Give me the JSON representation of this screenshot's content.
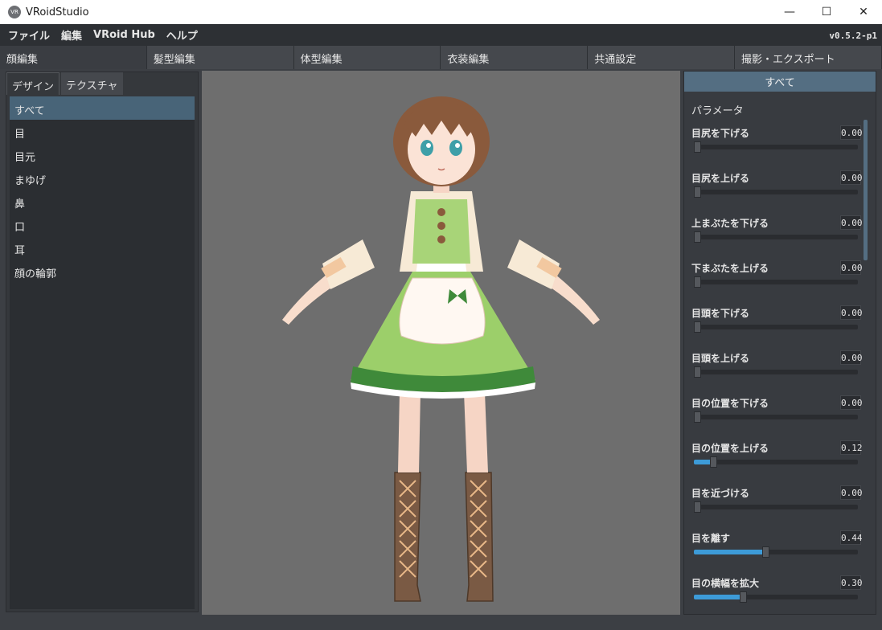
{
  "window": {
    "title": "VRoidStudio",
    "icon_text": "VR",
    "controls": {
      "minimize": "—",
      "maximize": "☐",
      "close": "✕"
    }
  },
  "menubar": {
    "items": [
      "ファイル",
      "編集",
      "VRoid Hub",
      "ヘルプ"
    ],
    "version": "v0.5.2-p1"
  },
  "main_tabs": [
    "顔編集",
    "髪型編集",
    "体型編集",
    "衣装編集",
    "共通設定",
    "撮影・エクスポート"
  ],
  "left_panel": {
    "subtabs": [
      "デザイン",
      "テクスチャ"
    ],
    "categories": [
      "すべて",
      "目",
      "目元",
      "まゆげ",
      "鼻",
      "口",
      "耳",
      "顔の輪郭"
    ]
  },
  "right_panel": {
    "header": "すべて",
    "section_label": "パラメータ",
    "params": [
      {
        "label": "目尻を下げる",
        "value": "0.00",
        "level": 0.0
      },
      {
        "label": "目尻を上げる",
        "value": "0.00",
        "level": 0.0
      },
      {
        "label": "上まぶたを下げる",
        "value": "0.00",
        "level": 0.0
      },
      {
        "label": "下まぶたを上げる",
        "value": "0.00",
        "level": 0.0
      },
      {
        "label": "目頭を下げる",
        "value": "0.00",
        "level": 0.0
      },
      {
        "label": "目頭を上げる",
        "value": "0.00",
        "level": 0.0
      },
      {
        "label": "目の位置を下げる",
        "value": "0.00",
        "level": 0.0
      },
      {
        "label": "目の位置を上げる",
        "value": "0.12",
        "level": 0.12
      },
      {
        "label": "目を近づける",
        "value": "0.00",
        "level": 0.0
      },
      {
        "label": "目を離す",
        "value": "0.44",
        "level": 0.44
      },
      {
        "label": "目の横幅を拡大",
        "value": "0.30",
        "level": 0.3
      }
    ]
  },
  "colors": {
    "accent": "#3d9bd8",
    "header": "#546e82",
    "selected_item": "#486478",
    "viewport_bg": "#6e6e6e",
    "hair": "#8a5a3c",
    "dress_green": "#9ccf6a",
    "dress_dark_green": "#3f8a3a",
    "boots": "#7a5a44"
  }
}
